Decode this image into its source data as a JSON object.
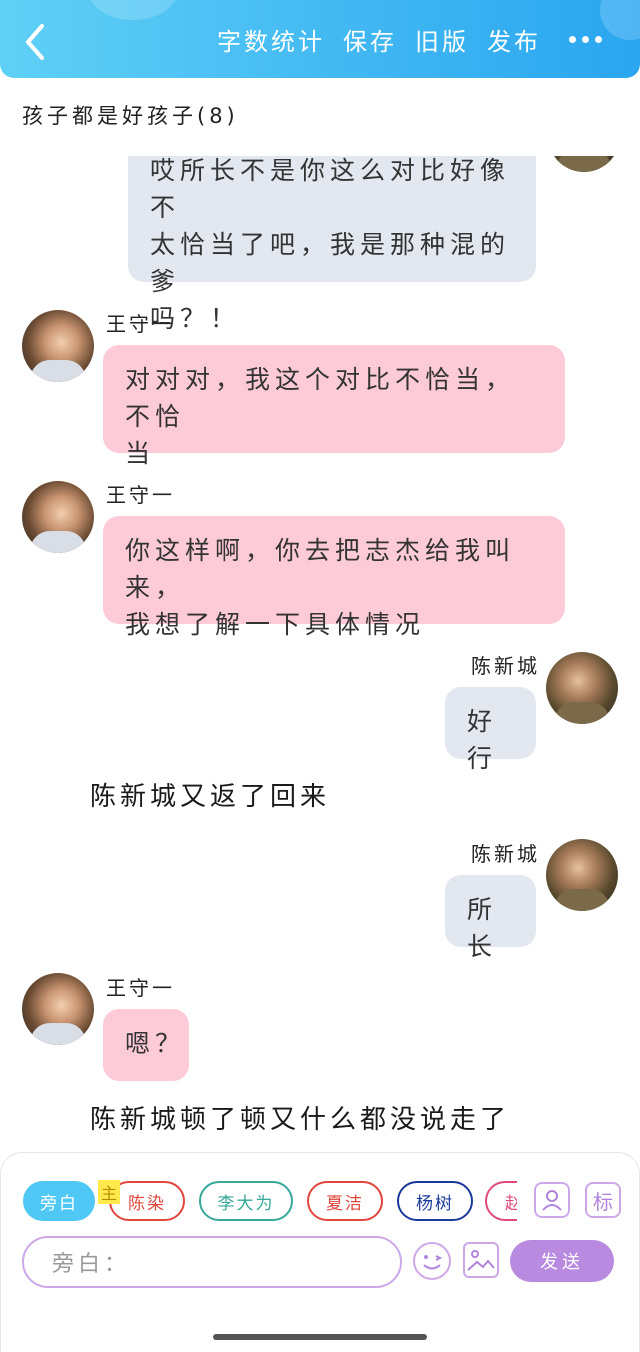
{
  "header": {
    "word_count": "字数统计",
    "save": "保存",
    "old_version": "旧版",
    "publish": "发布"
  },
  "chat": {
    "title": "孩子都是好孩子(8)",
    "messages": [
      {
        "speaker": "",
        "text_lines": [
          "哎所长不是你这么对比好像不",
          "太恰当了吧，我是那种混的爹",
          "吗？！"
        ]
      },
      {
        "speaker": "王守一",
        "text_lines": [
          "对对对，我这个对比不恰当，不恰",
          "当"
        ]
      },
      {
        "speaker": "王守一",
        "text_lines": [
          "你这样啊，你去把志杰给我叫来，",
          "我想了解一下具体情况"
        ]
      },
      {
        "speaker": "陈新城",
        "text_lines": [
          "好行"
        ]
      },
      {
        "narration": "陈新城又返了回来"
      },
      {
        "speaker": "陈新城",
        "text_lines": [
          "所长"
        ]
      },
      {
        "speaker": "王守一",
        "text_lines": [
          "嗯？"
        ]
      },
      {
        "narration": "陈新城顿了顿又什么都没说走了"
      }
    ]
  },
  "composer": {
    "roles": [
      {
        "label": "旁白",
        "color": "#4fc8f5"
      },
      {
        "label": "陈染",
        "color": "#e0463c"
      },
      {
        "label": "李大为",
        "color": "#37a89a"
      },
      {
        "label": "夏洁",
        "color": "#e0463c"
      },
      {
        "label": "杨树",
        "color": "#1a3a9a"
      },
      {
        "label": "赵",
        "color": "#e04a7a"
      }
    ],
    "main_tag": "主",
    "side_icon_label": "标",
    "input_placeholder": "旁白：",
    "send_label": "发送"
  },
  "colors": {
    "header_gradient": [
      "#5fd0f5",
      "#2aa6f0"
    ],
    "bubble_other": "#fdcbd8",
    "bubble_self": "#e3e8f0",
    "accent_purple": "#b88ae0"
  }
}
